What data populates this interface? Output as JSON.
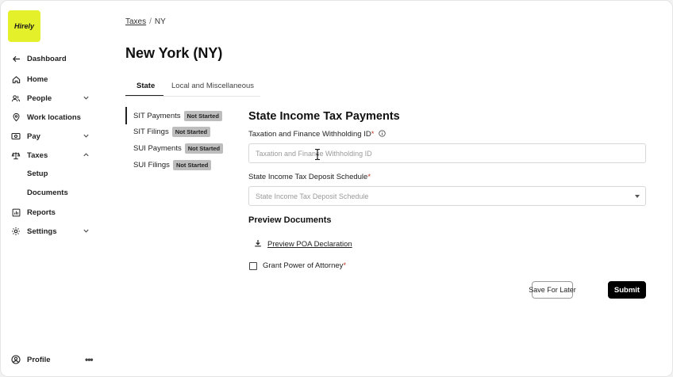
{
  "brand": {
    "logo_text": "Hirely",
    "accent": "#e4f02a"
  },
  "sidebar": {
    "back": {
      "label": "Dashboard",
      "icon": "arrow-left-icon"
    },
    "items": [
      {
        "label": "Home",
        "icon": "home-icon"
      },
      {
        "label": "People",
        "icon": "people-icon",
        "expandable": true
      },
      {
        "label": "Work locations",
        "icon": "location-pin-icon"
      },
      {
        "label": "Pay",
        "icon": "money-icon",
        "expandable": true
      },
      {
        "label": "Taxes",
        "icon": "scale-icon",
        "expanded": true
      },
      {
        "label": "Reports",
        "icon": "chart-icon"
      },
      {
        "label": "Settings",
        "icon": "gear-icon",
        "expandable": true
      }
    ],
    "taxes_children": [
      "Setup",
      "Documents"
    ],
    "profile": {
      "label": "Profile",
      "icon": "user-circle-icon"
    }
  },
  "breadcrumb": {
    "parent": "Taxes",
    "separator": "/",
    "current": "NY"
  },
  "page_title": "New York (NY)",
  "tabs": [
    {
      "label": "State",
      "active": true
    },
    {
      "label": "Local and Miscellaneous",
      "active": false
    }
  ],
  "subnav": [
    {
      "label": "SIT Payments",
      "status": "Not Started",
      "active": true
    },
    {
      "label": "SIT Filings",
      "status": "Not Started"
    },
    {
      "label": "SUI Payments",
      "status": "Not Started"
    },
    {
      "label": "SUI Filings",
      "status": "Not Started"
    }
  ],
  "form": {
    "title": "State Income Tax Payments",
    "withholding_id": {
      "label": "Taxation and Finance Withholding ID",
      "required_mark": "*",
      "placeholder": "Taxation and Finance Withholding ID",
      "value": ""
    },
    "deposit_schedule": {
      "label": "State Income Tax Deposit Schedule",
      "required_mark": "*",
      "placeholder": "State Income Tax Deposit Schedule"
    }
  },
  "preview": {
    "title": "Preview Documents",
    "link_label": "Preview POA Declaration",
    "checkbox_label": "Grant Power of Attorney",
    "checkbox_required_mark": "*",
    "checked": false
  },
  "actions": {
    "save_label": "Save For Later",
    "submit_label": "Submit"
  }
}
